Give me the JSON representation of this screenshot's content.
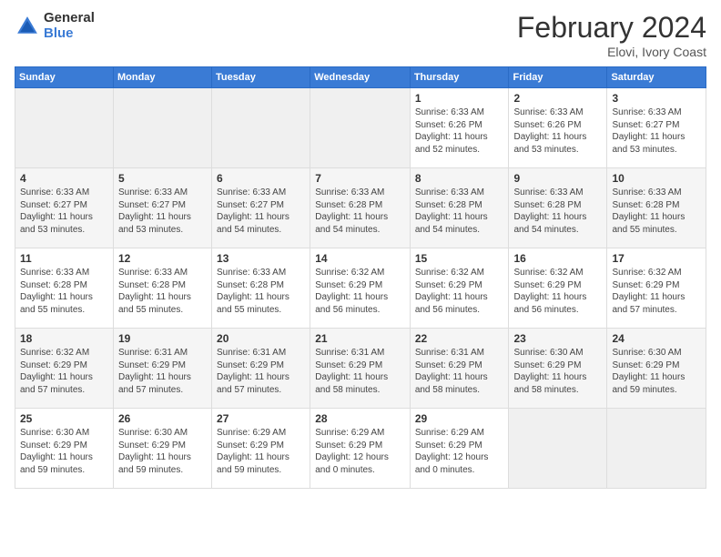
{
  "logo": {
    "general": "General",
    "blue": "Blue"
  },
  "header": {
    "month": "February 2024",
    "location": "Elovi, Ivory Coast"
  },
  "weekdays": [
    "Sunday",
    "Monday",
    "Tuesday",
    "Wednesday",
    "Thursday",
    "Friday",
    "Saturday"
  ],
  "weeks": [
    [
      {
        "day": "",
        "info": ""
      },
      {
        "day": "",
        "info": ""
      },
      {
        "day": "",
        "info": ""
      },
      {
        "day": "",
        "info": ""
      },
      {
        "day": "1",
        "info": "Sunrise: 6:33 AM\nSunset: 6:26 PM\nDaylight: 11 hours\nand 52 minutes."
      },
      {
        "day": "2",
        "info": "Sunrise: 6:33 AM\nSunset: 6:26 PM\nDaylight: 11 hours\nand 53 minutes."
      },
      {
        "day": "3",
        "info": "Sunrise: 6:33 AM\nSunset: 6:27 PM\nDaylight: 11 hours\nand 53 minutes."
      }
    ],
    [
      {
        "day": "4",
        "info": "Sunrise: 6:33 AM\nSunset: 6:27 PM\nDaylight: 11 hours\nand 53 minutes."
      },
      {
        "day": "5",
        "info": "Sunrise: 6:33 AM\nSunset: 6:27 PM\nDaylight: 11 hours\nand 53 minutes."
      },
      {
        "day": "6",
        "info": "Sunrise: 6:33 AM\nSunset: 6:27 PM\nDaylight: 11 hours\nand 54 minutes."
      },
      {
        "day": "7",
        "info": "Sunrise: 6:33 AM\nSunset: 6:28 PM\nDaylight: 11 hours\nand 54 minutes."
      },
      {
        "day": "8",
        "info": "Sunrise: 6:33 AM\nSunset: 6:28 PM\nDaylight: 11 hours\nand 54 minutes."
      },
      {
        "day": "9",
        "info": "Sunrise: 6:33 AM\nSunset: 6:28 PM\nDaylight: 11 hours\nand 54 minutes."
      },
      {
        "day": "10",
        "info": "Sunrise: 6:33 AM\nSunset: 6:28 PM\nDaylight: 11 hours\nand 55 minutes."
      }
    ],
    [
      {
        "day": "11",
        "info": "Sunrise: 6:33 AM\nSunset: 6:28 PM\nDaylight: 11 hours\nand 55 minutes."
      },
      {
        "day": "12",
        "info": "Sunrise: 6:33 AM\nSunset: 6:28 PM\nDaylight: 11 hours\nand 55 minutes."
      },
      {
        "day": "13",
        "info": "Sunrise: 6:33 AM\nSunset: 6:28 PM\nDaylight: 11 hours\nand 55 minutes."
      },
      {
        "day": "14",
        "info": "Sunrise: 6:32 AM\nSunset: 6:29 PM\nDaylight: 11 hours\nand 56 minutes."
      },
      {
        "day": "15",
        "info": "Sunrise: 6:32 AM\nSunset: 6:29 PM\nDaylight: 11 hours\nand 56 minutes."
      },
      {
        "day": "16",
        "info": "Sunrise: 6:32 AM\nSunset: 6:29 PM\nDaylight: 11 hours\nand 56 minutes."
      },
      {
        "day": "17",
        "info": "Sunrise: 6:32 AM\nSunset: 6:29 PM\nDaylight: 11 hours\nand 57 minutes."
      }
    ],
    [
      {
        "day": "18",
        "info": "Sunrise: 6:32 AM\nSunset: 6:29 PM\nDaylight: 11 hours\nand 57 minutes."
      },
      {
        "day": "19",
        "info": "Sunrise: 6:31 AM\nSunset: 6:29 PM\nDaylight: 11 hours\nand 57 minutes."
      },
      {
        "day": "20",
        "info": "Sunrise: 6:31 AM\nSunset: 6:29 PM\nDaylight: 11 hours\nand 57 minutes."
      },
      {
        "day": "21",
        "info": "Sunrise: 6:31 AM\nSunset: 6:29 PM\nDaylight: 11 hours\nand 58 minutes."
      },
      {
        "day": "22",
        "info": "Sunrise: 6:31 AM\nSunset: 6:29 PM\nDaylight: 11 hours\nand 58 minutes."
      },
      {
        "day": "23",
        "info": "Sunrise: 6:30 AM\nSunset: 6:29 PM\nDaylight: 11 hours\nand 58 minutes."
      },
      {
        "day": "24",
        "info": "Sunrise: 6:30 AM\nSunset: 6:29 PM\nDaylight: 11 hours\nand 59 minutes."
      }
    ],
    [
      {
        "day": "25",
        "info": "Sunrise: 6:30 AM\nSunset: 6:29 PM\nDaylight: 11 hours\nand 59 minutes."
      },
      {
        "day": "26",
        "info": "Sunrise: 6:30 AM\nSunset: 6:29 PM\nDaylight: 11 hours\nand 59 minutes."
      },
      {
        "day": "27",
        "info": "Sunrise: 6:29 AM\nSunset: 6:29 PM\nDaylight: 11 hours\nand 59 minutes."
      },
      {
        "day": "28",
        "info": "Sunrise: 6:29 AM\nSunset: 6:29 PM\nDaylight: 12 hours\nand 0 minutes."
      },
      {
        "day": "29",
        "info": "Sunrise: 6:29 AM\nSunset: 6:29 PM\nDaylight: 12 hours\nand 0 minutes."
      },
      {
        "day": "",
        "info": ""
      },
      {
        "day": "",
        "info": ""
      }
    ]
  ]
}
